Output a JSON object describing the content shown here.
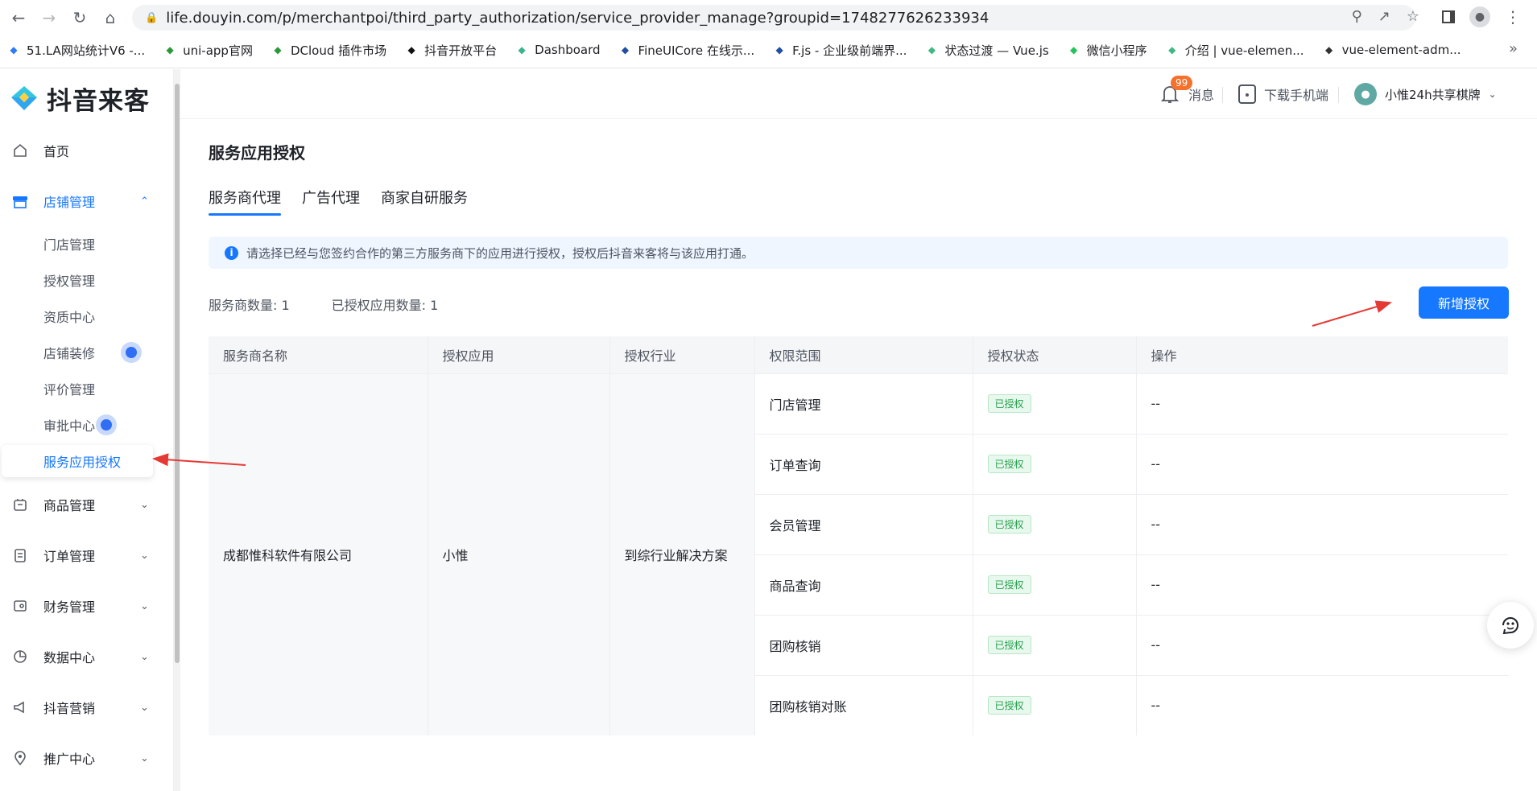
{
  "browser": {
    "url": "life.douyin.com/p/merchantpoi/third_party_authorization/service_provider_manage?groupid=1748277626233934",
    "bookmarks": [
      {
        "label": "51.LA网站统计V6 -...",
        "icon": "la-icon",
        "color": "#2f7af5"
      },
      {
        "label": "uni-app官网",
        "icon": "uniapp-icon",
        "color": "#2b9939"
      },
      {
        "label": "DCloud 插件市场",
        "icon": "dcloud-icon",
        "color": "#2b9939"
      },
      {
        "label": "抖音开放平台",
        "icon": "douyin-icon",
        "color": "#111111"
      },
      {
        "label": "Dashboard",
        "icon": "dashboard-icon",
        "color": "#3bb48a"
      },
      {
        "label": "FineUICore 在线示...",
        "icon": "fineui-icon",
        "color": "#1f4ea3"
      },
      {
        "label": "F.js - 企业级前端界...",
        "icon": "fjs-icon",
        "color": "#1f4ea3"
      },
      {
        "label": "状态过渡 — Vue.js",
        "icon": "vue-icon",
        "color": "#41b883"
      },
      {
        "label": "微信小程序",
        "icon": "wechat-icon",
        "color": "#21c35a"
      },
      {
        "label": "介绍 | vue-elemen...",
        "icon": "vue-element-icon",
        "color": "#41b883"
      },
      {
        "label": "vue-element-adm...",
        "icon": "vue-admin-icon",
        "color": "#333333"
      }
    ]
  },
  "app": {
    "logo_text": "抖音来客",
    "sidebar": {
      "items": [
        {
          "label": "首页",
          "icon": "home-icon"
        },
        {
          "label": "店铺管理",
          "icon": "store-icon",
          "active": true
        },
        {
          "label": "商品管理",
          "icon": "goods-icon"
        },
        {
          "label": "订单管理",
          "icon": "order-icon"
        },
        {
          "label": "财务管理",
          "icon": "finance-icon"
        },
        {
          "label": "数据中心",
          "icon": "data-icon"
        },
        {
          "label": "抖音营销",
          "icon": "marketing-icon"
        },
        {
          "label": "推广中心",
          "icon": "promotion-icon"
        }
      ],
      "sub_items": [
        "门店管理",
        "授权管理",
        "资质中心",
        "店铺装修",
        "评价管理",
        "审批中心",
        "服务应用授权"
      ]
    },
    "topbar": {
      "messages_label": "消息",
      "messages_badge": "99",
      "download_label": "下载手机端",
      "user_name": "小惟24h共享棋牌"
    },
    "main": {
      "title": "服务应用授权",
      "tabs": [
        "服务商代理",
        "广告代理",
        "商家自研服务"
      ],
      "alert": "请选择已经与您签约合作的第三方服务商下的应用进行授权，授权后抖音来客将与该应用打通。",
      "provider_count": "服务商数量: 1",
      "authorized_app_count": "已授权应用数量: 1",
      "add_button": "新增授权",
      "table": {
        "headers": [
          "服务商名称",
          "授权应用",
          "授权行业",
          "权限范围",
          "授权状态",
          "操作"
        ],
        "provider": "成都惟科软件有限公司",
        "app": "小惟",
        "industry": "到综行业解决方案",
        "rows": [
          {
            "scope": "门店管理",
            "status": "已授权",
            "action": "--"
          },
          {
            "scope": "订单查询",
            "status": "已授权",
            "action": "--"
          },
          {
            "scope": "会员管理",
            "status": "已授权",
            "action": "--"
          },
          {
            "scope": "商品查询",
            "status": "已授权",
            "action": "--"
          },
          {
            "scope": "团购核销",
            "status": "已授权",
            "action": "--"
          },
          {
            "scope": "团购核销对账",
            "status": "已授权",
            "action": "--"
          }
        ]
      }
    }
  },
  "colors": {
    "accent": "#1677ff",
    "annotation": "#e53935",
    "status_green": "#22a04b"
  }
}
